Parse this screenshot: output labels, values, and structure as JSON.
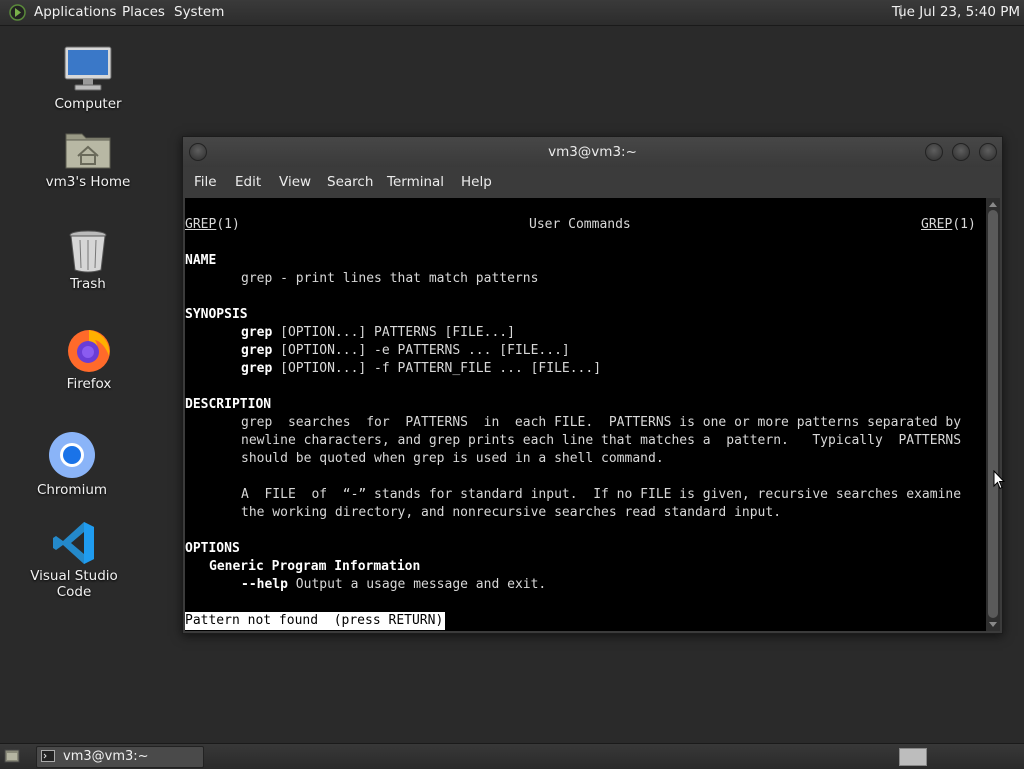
{
  "top_panel": {
    "menus": [
      "Applications",
      "Places",
      "System"
    ],
    "clock": "Tue Jul 23,  5:40 PM"
  },
  "desktop_icons": [
    {
      "label": "Computer",
      "icon": "computer-icon"
    },
    {
      "label": "vm3's Home",
      "icon": "home-folder-icon"
    },
    {
      "label": "Trash",
      "icon": "trash-icon"
    },
    {
      "label": "Firefox",
      "icon": "firefox-icon"
    },
    {
      "label": "Chromium",
      "icon": "chromium-icon"
    },
    {
      "label": "Visual Studio Code",
      "icon": "vscode-icon"
    }
  ],
  "window": {
    "title": "vm3@vm3:~",
    "menu": [
      "File",
      "Edit",
      "View",
      "Search",
      "Terminal",
      "Help"
    ]
  },
  "man": {
    "header_left": "GREP",
    "header_left_sec": "(1)",
    "header_center": "User Commands",
    "header_right": "GREP",
    "header_right_sec": "(1)",
    "name_heading": "NAME",
    "name_line": "grep - print lines that match patterns",
    "synopsis_heading": "SYNOPSIS",
    "synopsis": [
      {
        "cmd": "grep",
        "rest": "[OPTION...] PATTERNS [FILE...]"
      },
      {
        "cmd": "grep",
        "rest": "[OPTION...] -e PATTERNS ... [FILE...]"
      },
      {
        "cmd": "grep",
        "rest": "[OPTION...] -f PATTERN_FILE ... [FILE...]"
      }
    ],
    "description_heading": "DESCRIPTION",
    "description_p1": [
      "grep  searches  for  PATTERNS  in  each FILE.  PATTERNS is one or more patterns separated by",
      "newline characters, and grep prints each line that matches a  pattern.   Typically  PATTERNS",
      "should be quoted when grep is used in a shell command."
    ],
    "description_p2": [
      "A  FILE  of  “-” stands for standard input.  If no FILE is given, recursive searches examine",
      "the working directory, and nonrecursive searches read standard input."
    ],
    "options_heading": "OPTIONS",
    "options_sub": "Generic Program Information",
    "help_opt": "--help",
    "help_desc": " Output a usage message and exit.",
    "status": "Pattern not found  (press RETURN)"
  },
  "taskbar": {
    "task_label": "vm3@vm3:~"
  }
}
